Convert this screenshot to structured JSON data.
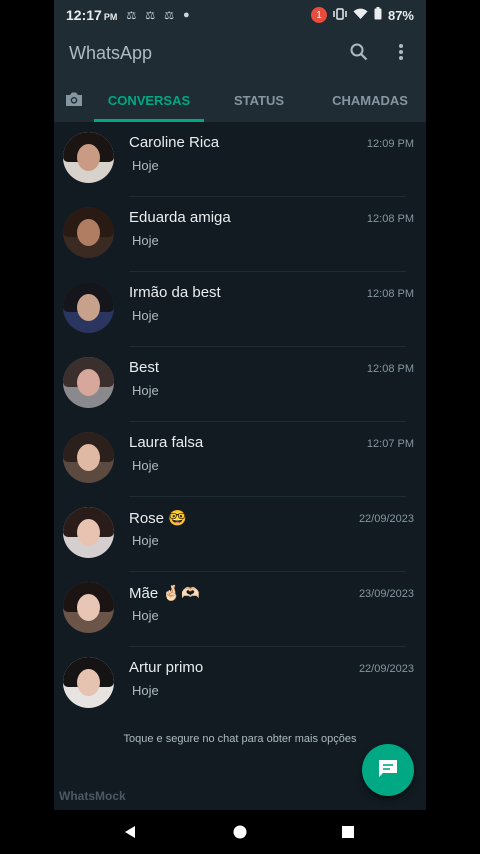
{
  "status_bar": {
    "time": "12:17",
    "ampm": "PM",
    "notification_count": "1",
    "battery": "87%"
  },
  "app": {
    "title": "WhatsApp",
    "tabs": [
      {
        "label": "CONVERSAS",
        "active": true
      },
      {
        "label": "STATUS",
        "active": false
      },
      {
        "label": "CHAMADAS",
        "active": false
      }
    ]
  },
  "chats": [
    {
      "name": "Caroline Rica",
      "message": "Hoje",
      "time": "12:09 PM"
    },
    {
      "name": "Eduarda amiga",
      "message": "Hoje",
      "time": "12:08 PM"
    },
    {
      "name": "Irmão da best",
      "message": "Hoje",
      "time": "12:08 PM"
    },
    {
      "name": "Best",
      "message": "Hoje",
      "time": "12:08 PM"
    },
    {
      "name": "Laura falsa",
      "message": "Hoje",
      "time": "12:07 PM"
    },
    {
      "name": "Rose 🤓",
      "message": "Hoje",
      "time": "22/09/2023"
    },
    {
      "name": "Mãe 🤞🏻🫶🏻",
      "message": "Hoje",
      "time": "23/09/2023"
    },
    {
      "name": "Artur primo",
      "message": "Hoje",
      "time": "22/09/2023"
    }
  ],
  "hint": "Toque e segure no chat para obter mais opções",
  "watermark": "WhatsMock",
  "colors": {
    "accent": "#00a884",
    "background": "#111b21",
    "header": "#1f2c34"
  }
}
